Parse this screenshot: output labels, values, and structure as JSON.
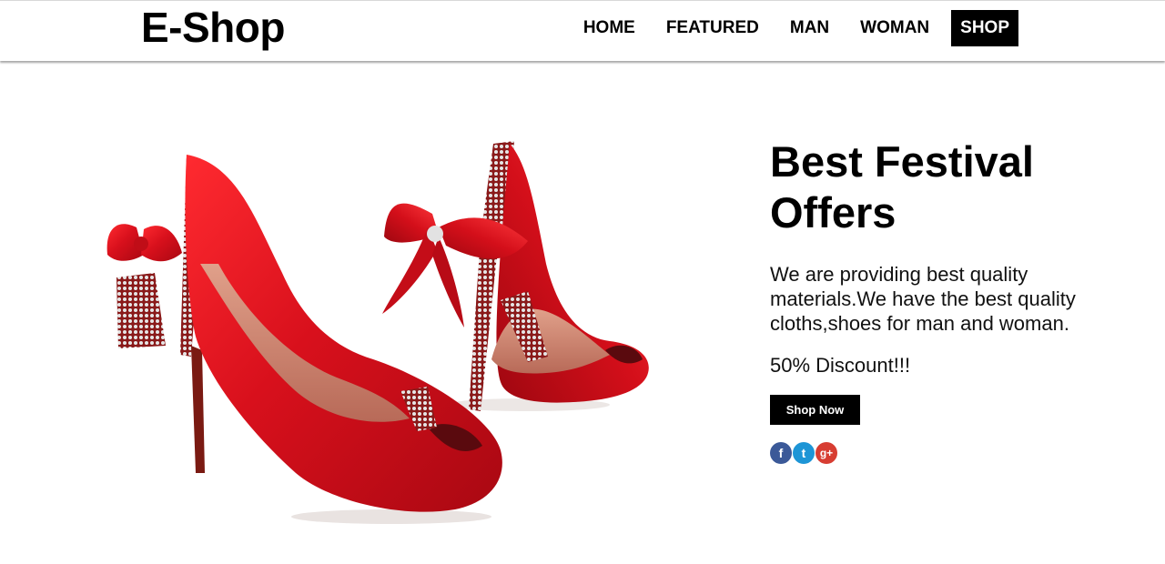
{
  "header": {
    "brand": "E-Shop",
    "nav": [
      {
        "label": "HOME",
        "active": false
      },
      {
        "label": "FEATURED",
        "active": false
      },
      {
        "label": "MAN",
        "active": false
      },
      {
        "label": "WOMAN",
        "active": false
      },
      {
        "label": "SHOP",
        "active": true
      }
    ]
  },
  "hero": {
    "image_icon": "red-high-heel-shoes-image",
    "headline": "Best Festival Offers",
    "description": "We are providing best quality materials.We have the best quality cloths,shoes for man and woman.",
    "discount": "50% Discount!!!",
    "button_label": "Shop Now"
  },
  "social": [
    {
      "icon": "facebook-icon",
      "glyph": "f",
      "color": "#3b5998"
    },
    {
      "icon": "twitter-icon",
      "glyph": "t",
      "color": "#1d95d6"
    },
    {
      "icon": "google-plus-icon",
      "glyph": "g+",
      "color": "#d73d32"
    }
  ],
  "colors": {
    "accent": "#000000",
    "shoe_red": "#d8101c",
    "heel_sole": "#c98a70"
  }
}
